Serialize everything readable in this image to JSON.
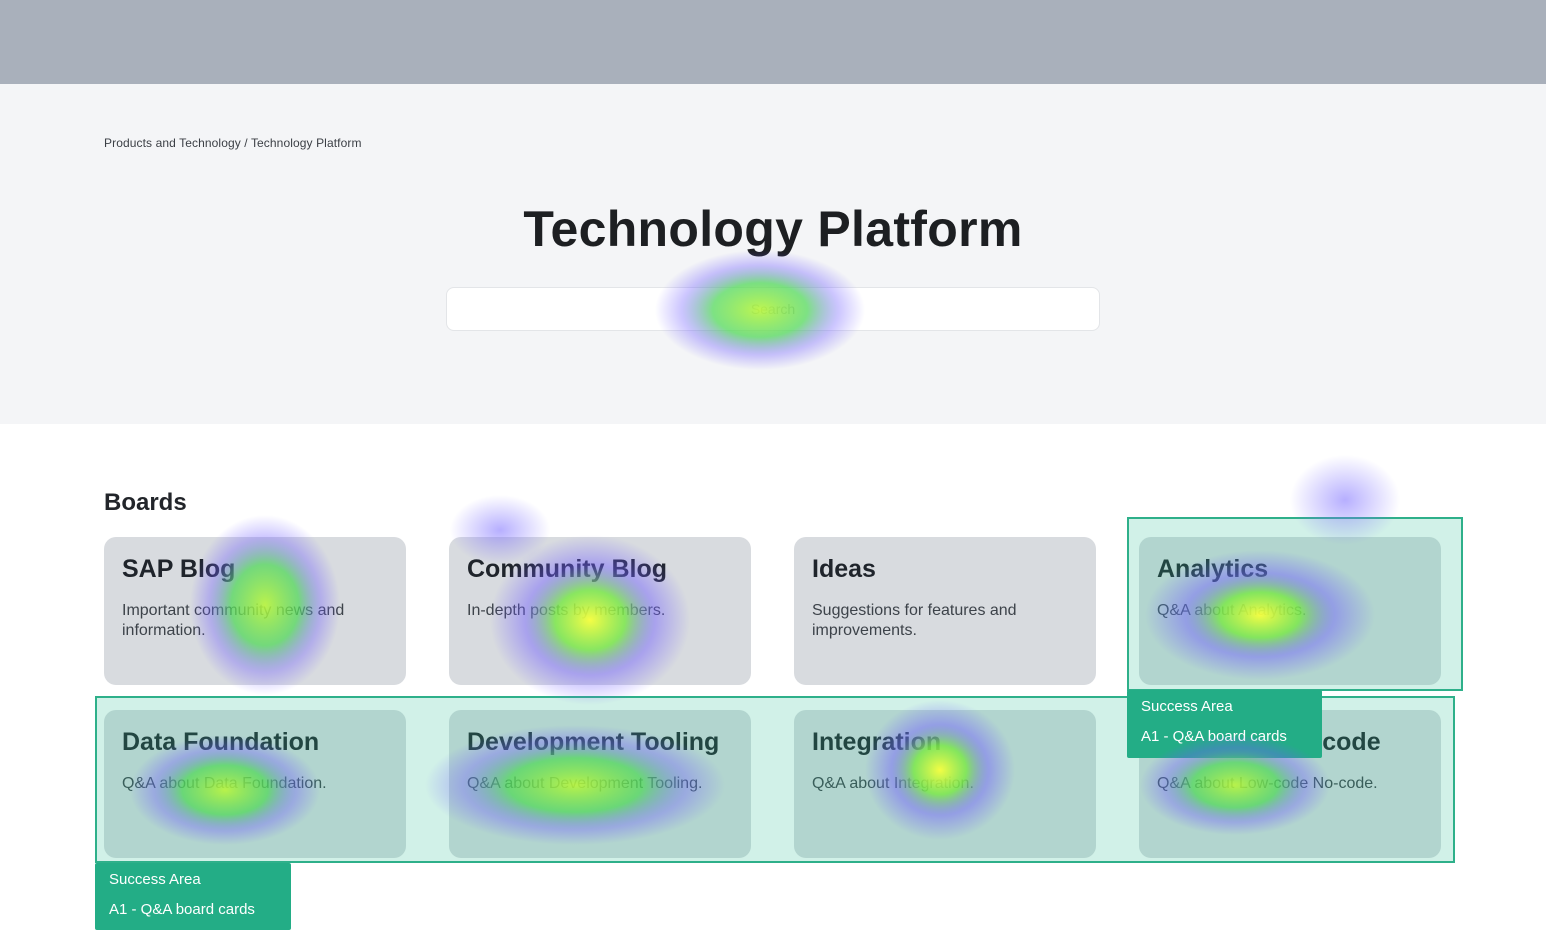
{
  "breadcrumb": {
    "parent": "Products and Technology",
    "separator": " / ",
    "current": "Technology Platform"
  },
  "page": {
    "title": "Technology Platform"
  },
  "search": {
    "placeholder": "Search"
  },
  "boards": {
    "heading": "Boards",
    "items": [
      {
        "title": "SAP Blog",
        "description": "Important community news and information."
      },
      {
        "title": "Community Blog",
        "description": "In-depth posts by members."
      },
      {
        "title": "Ideas",
        "description": "Suggestions for features and improvements."
      },
      {
        "title": "Analytics",
        "description": "Q&A about Analytics."
      },
      {
        "title": "Data Foundation",
        "description": "Q&A about Data Foundation."
      },
      {
        "title": "Development Tooling",
        "description": "Q&A about Development Tooling."
      },
      {
        "title": "Integration",
        "description": "Q&A about Integration."
      },
      {
        "title": "Low-code No-code",
        "description": "Q&A about Low-code No-code."
      }
    ]
  },
  "success_areas": [
    {
      "label_line1": "Success Area",
      "label_line2": "A1 - Q&A board cards"
    },
    {
      "label_line1": "Success Area",
      "label_line2": "A1 - Q&A board cards"
    }
  ],
  "colors": {
    "success_area": "#23ad86",
    "heatmap_hot": "#f6ff3d",
    "heatmap_mid": "#5be35a",
    "heatmap_cool": "#6f5cff"
  }
}
